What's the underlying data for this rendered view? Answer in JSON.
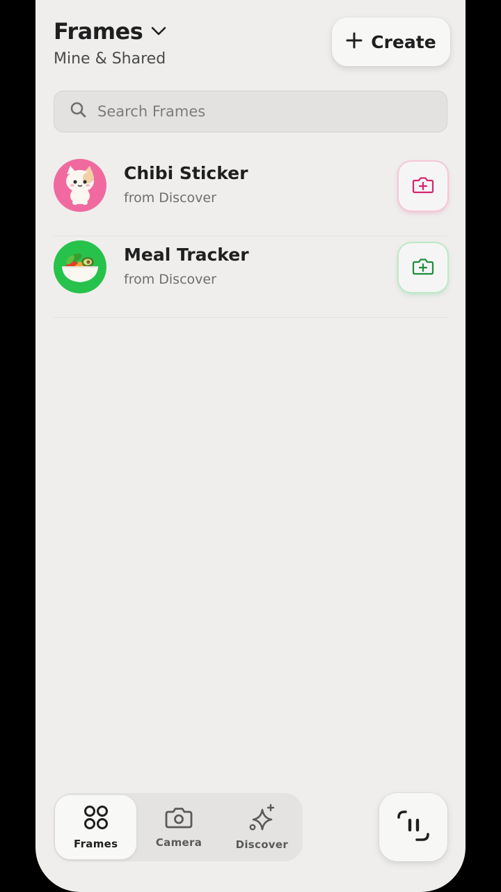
{
  "header": {
    "title": "Frames",
    "subtitle": "Mine & Shared",
    "create_label": "Create"
  },
  "search": {
    "placeholder": "Search Frames"
  },
  "frames": [
    {
      "title": "Chibi Sticker",
      "subtitle": "from Discover",
      "icon": "cat-sticker-icon",
      "accent": "#d6246e",
      "avatar_bg": "#f06aa0"
    },
    {
      "title": "Meal Tracker",
      "subtitle": "from Discover",
      "icon": "salad-bowl-icon",
      "accent": "#1e8c3c",
      "avatar_bg": "#27c24c"
    }
  ],
  "tabs": [
    {
      "label": "Frames",
      "icon": "grid-icon",
      "active": true
    },
    {
      "label": "Camera",
      "icon": "camera-icon",
      "active": false
    },
    {
      "label": "Discover",
      "icon": "sparkle-icon",
      "active": false
    }
  ],
  "side_button": {
    "icon": "scan-face-icon"
  }
}
